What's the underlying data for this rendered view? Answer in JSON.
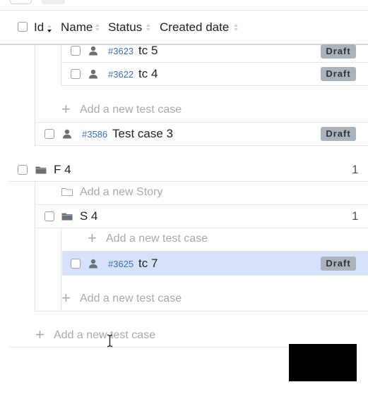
{
  "header": {
    "id_label": "Id",
    "name_label": "Name",
    "status_label": "Status",
    "created_label": "Created date"
  },
  "rows": {
    "tc5": {
      "id": "#3623",
      "name": "tc 5",
      "status": "Draft"
    },
    "tc4": {
      "id": "#3622",
      "name": "tc 4",
      "status": "Draft"
    },
    "add_test_case_1": "Add a new test case",
    "tc3": {
      "id": "#3586",
      "name": "Test case 3",
      "status": "Draft"
    },
    "folder_f4": {
      "name": "F 4",
      "count": "1"
    },
    "add_story": "Add a new Story",
    "story_s4": {
      "name": "S 4",
      "count": "1"
    },
    "add_test_case_2": "Add a new test case",
    "tc7": {
      "id": "#3625",
      "name": "tc 7",
      "status": "Draft"
    },
    "add_test_case_3": "Add a new test case",
    "add_test_case_4": "Add a new test case"
  },
  "colors": {
    "selected_row": "#d6e1fb",
    "badge_bg": "#aab2bb",
    "id_link": "#3d6fb5"
  }
}
